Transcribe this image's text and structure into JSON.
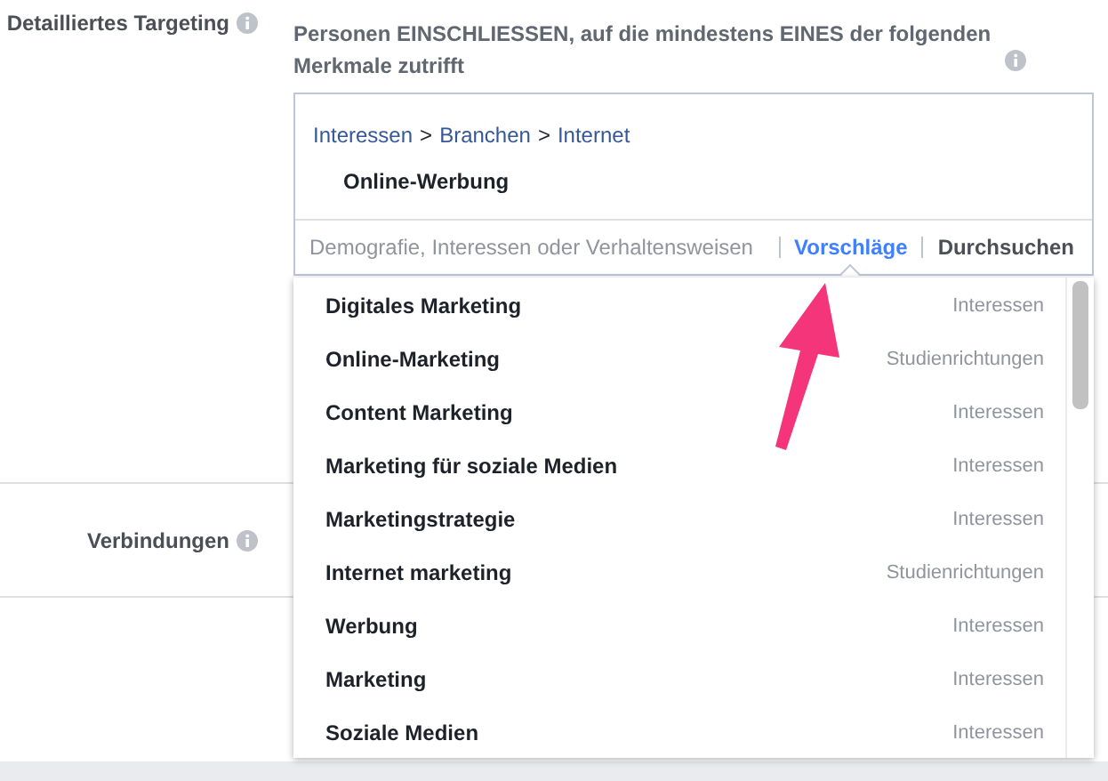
{
  "sections": [
    {
      "label": "Detailliertes Targeting",
      "info": true
    },
    {
      "label": "Verbindungen",
      "info": true
    }
  ],
  "targeting": {
    "heading": "Personen EINSCHLIESSEN, auf die mindestens EINES der folgenden Merkmale zutrifft",
    "breadcrumb": [
      "Interessen",
      "Branchen",
      "Internet"
    ],
    "separator": ">",
    "selected_item": "Online-Werbung",
    "search": {
      "placeholder": "Demografie, Interessen oder Verhaltensweisen"
    },
    "tabs": [
      {
        "label": "Vorschläge",
        "selected": true
      },
      {
        "label": "Durchsuchen",
        "selected": false
      }
    ]
  },
  "suggestions": [
    {
      "name": "Digitales Marketing",
      "category": "Interessen"
    },
    {
      "name": "Online-Marketing",
      "category": "Studienrichtungen"
    },
    {
      "name": "Content Marketing",
      "category": "Interessen"
    },
    {
      "name": "Marketing für soziale Medien",
      "category": "Interessen"
    },
    {
      "name": "Marketingstrategie",
      "category": "Interessen"
    },
    {
      "name": "Internet marketing",
      "category": "Studienrichtungen"
    },
    {
      "name": "Werbung",
      "category": "Interessen"
    },
    {
      "name": "Marketing",
      "category": "Interessen"
    },
    {
      "name": "Soziale Medien",
      "category": "Interessen"
    }
  ]
}
